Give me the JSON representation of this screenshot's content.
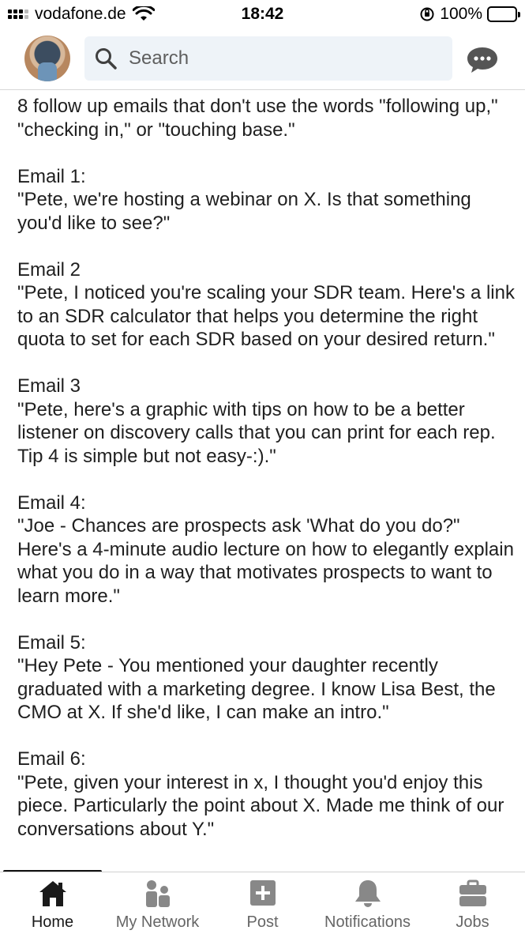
{
  "status_bar": {
    "carrier": "vodafone.de",
    "time": "18:42",
    "battery": "100%"
  },
  "header": {
    "search_placeholder": "Search"
  },
  "post": {
    "intro": "8 follow up emails that don't use the words \"following up,\" \"checking in,\" or \"touching base.\"",
    "emails": [
      {
        "title": "Email 1:",
        "body": "\"Pete, we're hosting a webinar on X. Is that something you'd like to see?\""
      },
      {
        "title": "Email 2",
        "body": "\"Pete, I noticed you're scaling your SDR team. Here's a link to an SDR calculator that helps you determine the right quota to set for each SDR based on your desired return.\""
      },
      {
        "title": "Email 3",
        "body": "\"Pete, here's a graphic with tips on how to be a better listener on discovery calls that you can print for each rep. Tip 4 is simple but not easy-:).\""
      },
      {
        "title": "Email 4:",
        "body": "\"Joe - Chances are prospects ask 'What do you do?\" Here's a 4-minute audio lecture on how to elegantly explain what you do in a way that motivates prospects to want to learn more.\""
      },
      {
        "title": "Email 5:",
        "body": "\"Hey Pete - You mentioned your daughter recently graduated with a marketing degree. I know Lisa Best, the CMO at X. If she'd like, I can make an intro.\""
      },
      {
        "title": "Email 6:",
        "body": "\"Pete, given your interest in x, I thought you'd enjoy this piece. Particularly the point about X. Made me think of our conversations about Y.\""
      }
    ]
  },
  "bottom_nav": {
    "items": [
      {
        "label": "Home",
        "icon": "home-icon",
        "active": true
      },
      {
        "label": "My Network",
        "icon": "my-network-icon",
        "active": false
      },
      {
        "label": "Post",
        "icon": "post-icon",
        "active": false
      },
      {
        "label": "Notifications",
        "icon": "bell-icon",
        "active": false
      },
      {
        "label": "Jobs",
        "icon": "briefcase-icon",
        "active": false
      }
    ]
  },
  "colors": {
    "search_bg": "#eef3f8",
    "battery_fill": "#34c759",
    "nav_active": "#1a1a1a",
    "nav_inactive": "#666666"
  }
}
